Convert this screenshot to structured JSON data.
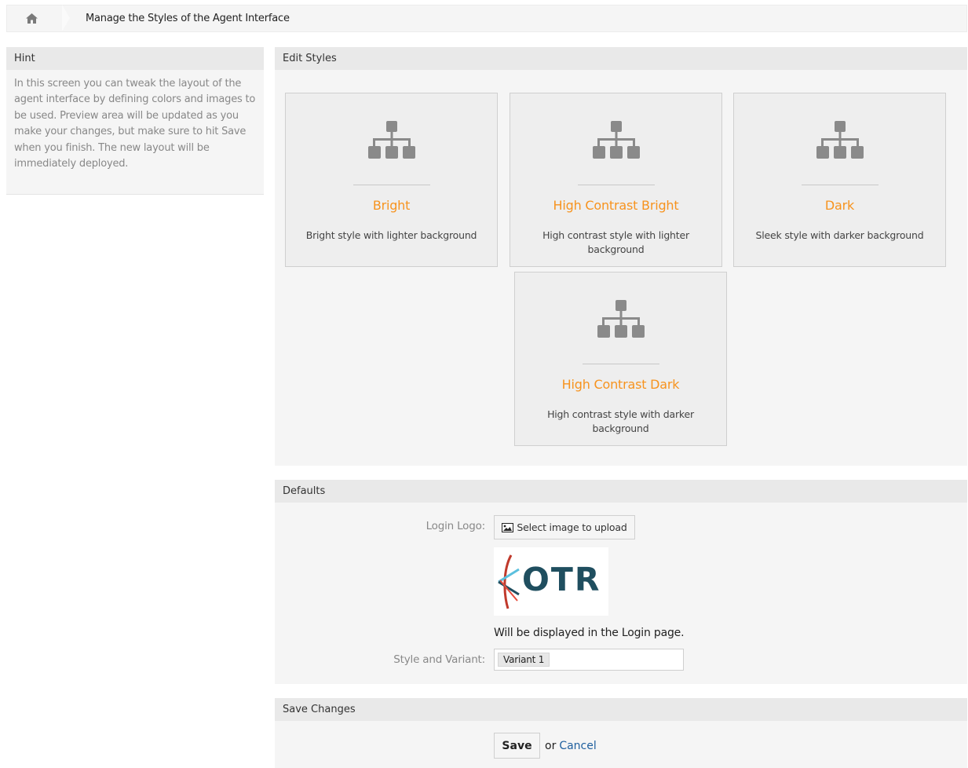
{
  "breadcrumb": {
    "home_icon": "home-icon",
    "title": "Manage the Styles of the Agent Interface"
  },
  "hint": {
    "title": "Hint",
    "text": "In this screen you can tweak the layout of the agent interface by defining colors and images to be used. Preview area will be updated as you make your changes, but make sure to hit Save when you finish. The new layout will be immediately deployed."
  },
  "edit_styles": {
    "title": "Edit Styles",
    "styles": [
      {
        "name": "Bright",
        "description": "Bright style with lighter background",
        "icon": "sitemap-icon"
      },
      {
        "name": "High Contrast Bright",
        "description": "High contrast style with lighter background",
        "icon": "sitemap-icon"
      },
      {
        "name": "Dark",
        "description": "Sleek style with darker background",
        "icon": "sitemap-icon"
      },
      {
        "name": "High Contrast Dark",
        "description": "High contrast style with darker background",
        "icon": "sitemap-icon"
      }
    ]
  },
  "defaults": {
    "title": "Defaults",
    "login_logo_label": "Login Logo:",
    "upload_button": "Select image to upload",
    "upload_icon": "image-icon",
    "logo_text": "OTR",
    "logo_note": "Will be displayed in the Login page.",
    "variant_label": "Style and Variant:",
    "variant_value": "Variant 1"
  },
  "save_changes": {
    "title": "Save Changes",
    "save_button": "Save",
    "or_text": "or",
    "cancel_link": "Cancel"
  },
  "colors": {
    "accent": "#f7931e",
    "link": "#1e5f9e",
    "logo": "#1f4e5f"
  }
}
